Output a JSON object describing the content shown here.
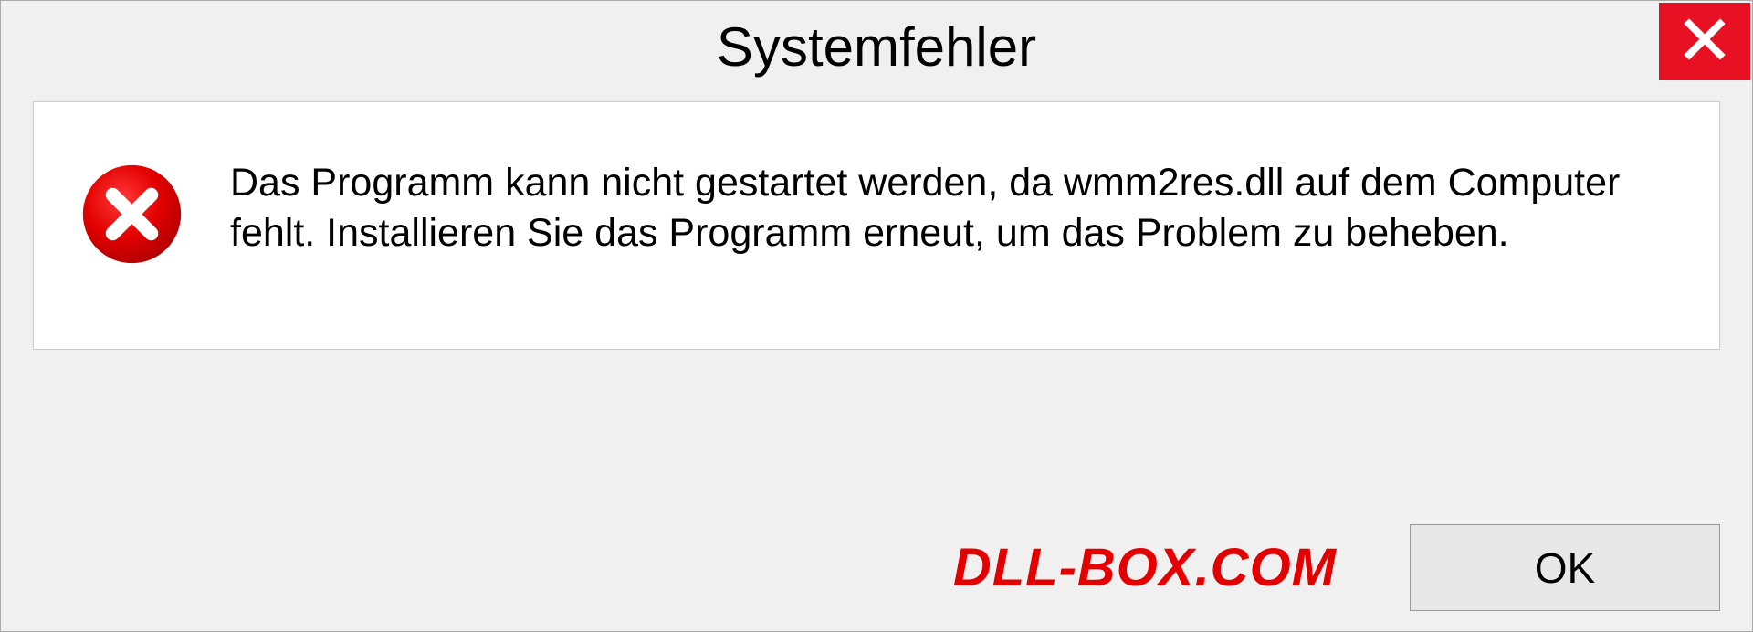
{
  "dialog": {
    "title": "Systemfehler",
    "message": "Das Programm kann nicht gestartet werden, da wmm2res.dll auf dem Computer fehlt. Installieren Sie das Programm erneut, um das Problem zu beheben.",
    "ok_label": "OK"
  },
  "watermark": {
    "text": "DLL-BOX.COM"
  },
  "colors": {
    "close_bg": "#e81123",
    "error_red": "#e30000",
    "panel_bg": "#ffffff",
    "window_bg": "#f0f0f0"
  }
}
